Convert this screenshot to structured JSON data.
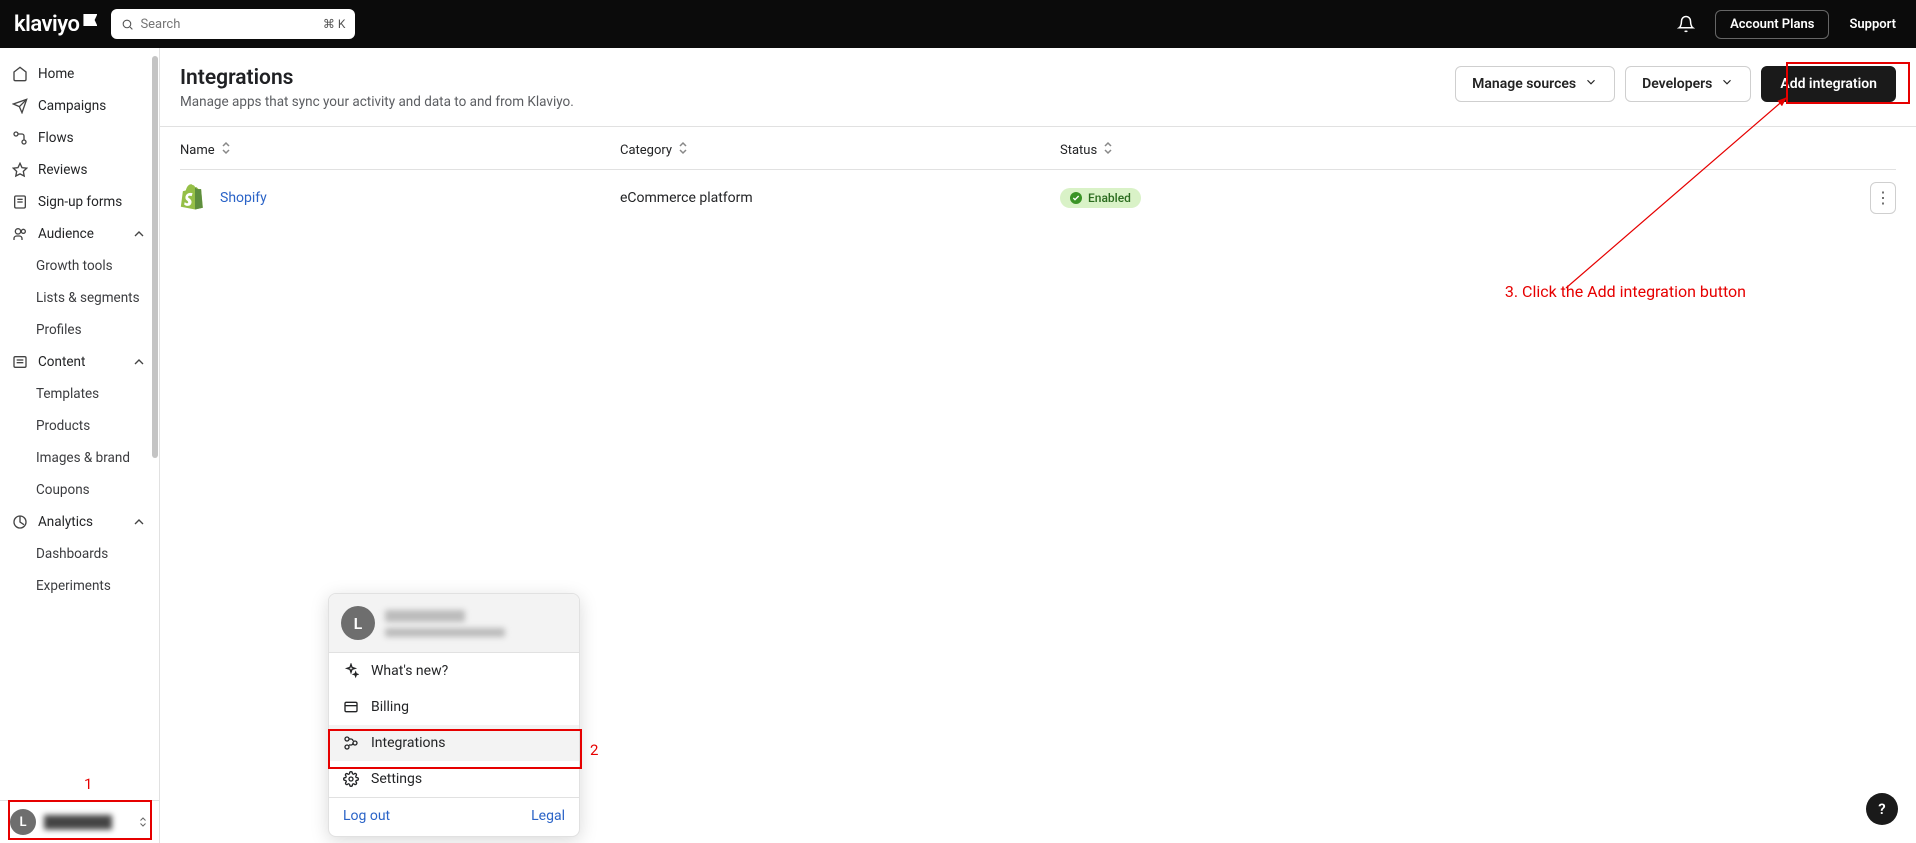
{
  "topbar": {
    "logo": "klaviyo",
    "search_placeholder": "Search",
    "search_kbd": "⌘ K",
    "account_plans": "Account Plans",
    "support": "Support"
  },
  "sidebar": {
    "home": "Home",
    "campaigns": "Campaigns",
    "flows": "Flows",
    "reviews": "Reviews",
    "signup_forms": "Sign-up forms",
    "audience": "Audience",
    "audience_sub": {
      "growth_tools": "Growth tools",
      "lists_segments": "Lists & segments",
      "profiles": "Profiles"
    },
    "content": "Content",
    "content_sub": {
      "templates": "Templates",
      "products": "Products",
      "images_brand": "Images & brand",
      "coupons": "Coupons"
    },
    "analytics": "Analytics",
    "analytics_sub": {
      "dashboards": "Dashboards",
      "experiments": "Experiments"
    },
    "footer_initial": "L"
  },
  "header": {
    "title": "Integrations",
    "subtitle": "Manage apps that sync your activity and data to and from Klaviyo.",
    "manage_sources": "Manage sources",
    "developers": "Developers",
    "add_integration": "Add integration"
  },
  "table": {
    "col_name": "Name",
    "col_category": "Category",
    "col_status": "Status",
    "rows": [
      {
        "name": "Shopify",
        "category": "eCommerce platform",
        "status": "Enabled"
      }
    ]
  },
  "account_popup": {
    "initial": "L",
    "whats_new": "What's new?",
    "billing": "Billing",
    "integrations": "Integrations",
    "settings": "Settings",
    "log_out": "Log out",
    "legal": "Legal"
  },
  "annotations": {
    "num1": "1",
    "num2": "2",
    "text3": "3. Click the Add integration button"
  },
  "help": "?"
}
